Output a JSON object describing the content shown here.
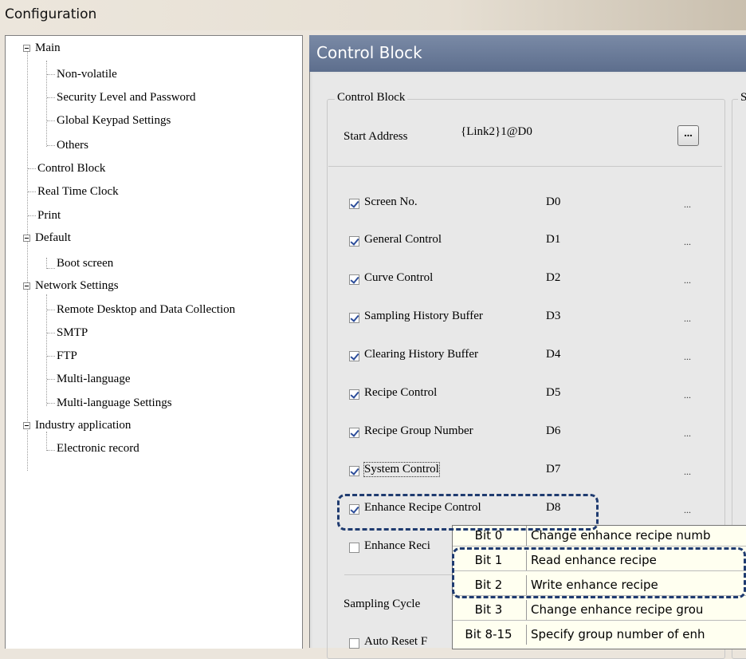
{
  "window": {
    "title": "Configuration"
  },
  "tree": {
    "main": "Main",
    "non_volatile": "Non-volatile",
    "security": "Security Level and Password",
    "global_keypad": "Global Keypad Settings",
    "others": "Others",
    "control_block": "Control Block",
    "real_time_clock": "Real Time Clock",
    "print": "Print",
    "default": "Default",
    "boot_screen": "Boot screen",
    "network_settings": "Network Settings",
    "remote_desktop": "Remote Desktop and Data Collection",
    "smtp": "SMTP",
    "ftp": "FTP",
    "multi_language": "Multi-language",
    "multi_language_settings": "Multi-language Settings",
    "industry_application": "Industry application",
    "electronic_record": "Electronic record"
  },
  "panel": {
    "header": "Control Block",
    "group_title": "Control Block",
    "right_group_partial": "S",
    "start_address_label": "Start Address",
    "start_address_value": "{Link2}1@D0",
    "browse_label": "...",
    "items": [
      {
        "label": "Screen No.",
        "address": "D0",
        "checked": true,
        "more": "..."
      },
      {
        "label": "General Control",
        "address": "D1",
        "checked": true,
        "more": "..."
      },
      {
        "label": "Curve Control",
        "address": "D2",
        "checked": true,
        "more": "..."
      },
      {
        "label": "Sampling History Buffer",
        "address": "D3",
        "checked": true,
        "more": "..."
      },
      {
        "label": "Clearing History Buffer",
        "address": "D4",
        "checked": true,
        "more": "..."
      },
      {
        "label": "Recipe Control",
        "address": "D5",
        "checked": true,
        "more": "..."
      },
      {
        "label": "Recipe Group Number",
        "address": "D6",
        "checked": true,
        "more": "..."
      },
      {
        "label": "System Control",
        "address": "D7",
        "checked": true,
        "more": "..."
      },
      {
        "label": "Enhance Recipe Control",
        "address": "D8",
        "checked": true,
        "more": "..."
      },
      {
        "label": "Enhance Reci",
        "address": "",
        "checked": false,
        "more": ""
      }
    ],
    "sampling_cycle_label": "Sampling Cycle",
    "auto_reset_label": "Auto Reset F"
  },
  "tooltip": {
    "rows": [
      {
        "bit": "Bit 0",
        "desc": "Change enhance recipe numb"
      },
      {
        "bit": "Bit 1",
        "desc": "Read enhance recipe"
      },
      {
        "bit": "Bit 2",
        "desc": "Write enhance recipe"
      },
      {
        "bit": "Bit 3",
        "desc": "Change enhance recipe grou"
      },
      {
        "bit": "Bit 8-15",
        "desc": "Specify group number of enh"
      }
    ]
  },
  "colors": {
    "header_bg": "#5d6e8d",
    "highlight_border": "#1f3b70",
    "tooltip_bg": "#fffff0"
  }
}
